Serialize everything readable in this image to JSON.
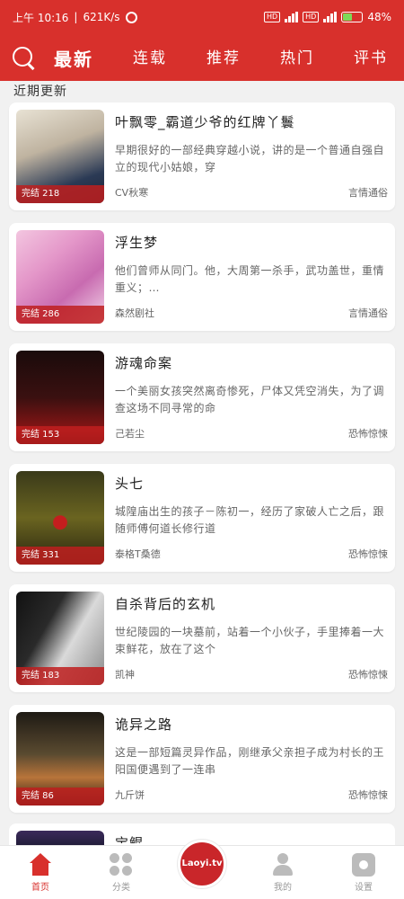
{
  "status": {
    "time": "上午 10:16",
    "speed": "621K/s",
    "battery": "48%",
    "battery_level": 0.48,
    "sim1": "HD",
    "sim2": "HD"
  },
  "nav": {
    "tabs": [
      "最新",
      "连载",
      "推荐",
      "热门",
      "评书"
    ]
  },
  "section_title": "近期更新",
  "books": [
    {
      "title": "叶飘零_霸道少爷的红牌丫鬟",
      "badge": "完结 218",
      "desc": "早期很好的一部经典穿越小说，讲的是一个普通自强自立的现代小姑娘，穿",
      "author": "CV秋寒",
      "genre": "言情通俗"
    },
    {
      "title": "浮生梦",
      "badge": "完结 286",
      "desc": "他们曾师从同门。他，大周第一杀手，武功盖世，重情重义；…",
      "author": "森然剧社",
      "genre": "言情通俗"
    },
    {
      "title": "游魂命案",
      "badge": "完结 153",
      "desc": "一个美丽女孩突然离奇惨死，尸体又凭空消失，为了调查这场不同寻常的命",
      "author": "己若尘",
      "genre": "恐怖惊悚"
    },
    {
      "title": "头七",
      "badge": "完结 331",
      "desc": "城隍庙出生的孩子－陈初一，经历了家破人亡之后，跟随师傅何道长修行道",
      "author": "泰格T桑德",
      "genre": "恐怖惊悚"
    },
    {
      "title": "自杀背后的玄机",
      "badge": "完结 183",
      "desc": "世纪陵园的一块墓前，站着一个小伙子，手里捧着一大束鲜花，放在了这个",
      "author": "凯神",
      "genre": "恐怖惊悚"
    },
    {
      "title": "诡异之路",
      "badge": "完结 86",
      "desc": "这是一部短篇灵异作品，刚继承父亲担子成为村长的王阳国便遇到了一连串",
      "author": "九斤饼",
      "genre": "恐怖惊悚"
    }
  ],
  "partial_book": {
    "title": "宝鲲"
  },
  "bottom_nav": {
    "home": "首页",
    "category": "分类",
    "logo": "Laoyi.tv",
    "mine": "我的",
    "settings": "设置"
  }
}
